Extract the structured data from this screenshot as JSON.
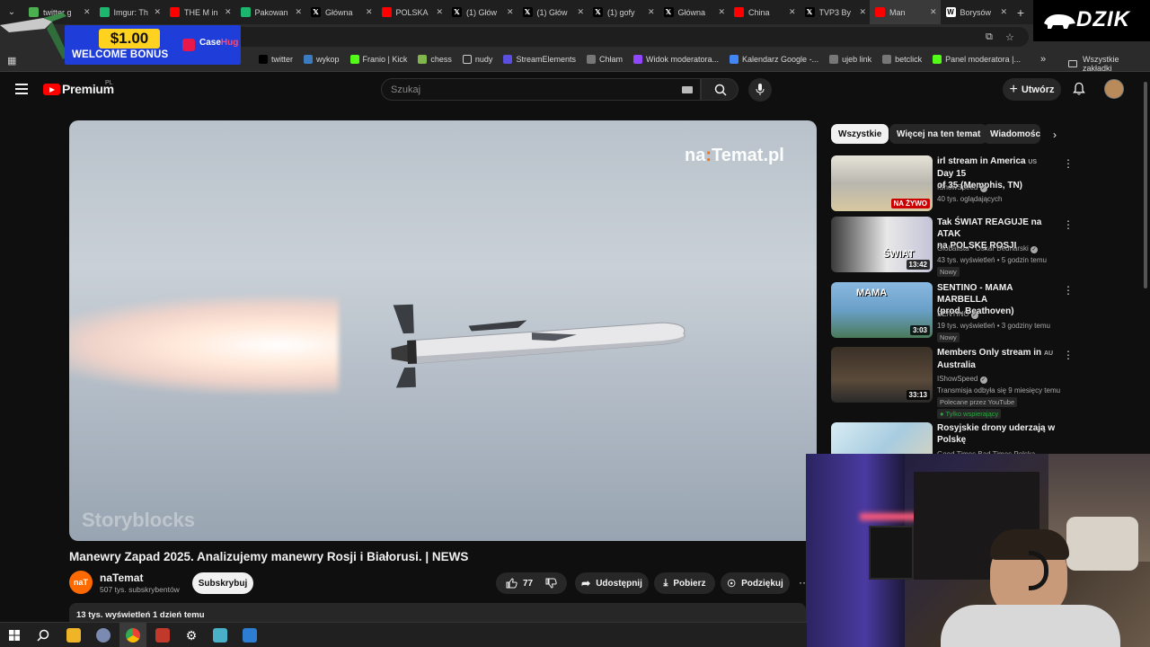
{
  "browser": {
    "tabs": [
      {
        "label": "twitter g",
        "favicon": "chrome-icon",
        "color": "#4caf50"
      },
      {
        "label": "Imgur: Th",
        "favicon": "imgur-icon",
        "color": "#1bb76e"
      },
      {
        "label": "THE M in",
        "favicon": "youtube-icon",
        "color": "#ff0000"
      },
      {
        "label": "Pakowan",
        "favicon": "imgur-icon",
        "color": "#1bb76e"
      },
      {
        "label": "Główna",
        "favicon": "x-icon",
        "color": "#000000"
      },
      {
        "label": "POLSKA",
        "favicon": "youtube-icon",
        "color": "#ff0000"
      },
      {
        "label": "(1) Głów",
        "favicon": "x-icon",
        "color": "#000000"
      },
      {
        "label": "(1) Głów",
        "favicon": "x-icon",
        "color": "#000000"
      },
      {
        "label": "(1) gofy",
        "favicon": "x-icon",
        "color": "#000000"
      },
      {
        "label": "Główna",
        "favicon": "x-icon",
        "color": "#000000"
      },
      {
        "label": "China",
        "favicon": "youtube-icon",
        "color": "#ff0000"
      },
      {
        "label": "TVP3 By",
        "favicon": "x-icon",
        "color": "#000000"
      },
      {
        "label": "Man",
        "favicon": "youtube-icon",
        "color": "#ff0000"
      },
      {
        "label": "Borysów",
        "favicon": "wikipedia-icon",
        "color": "#ffffff"
      }
    ],
    "bookmarks": [
      {
        "label": "twitter",
        "icon": "x-icon"
      },
      {
        "label": "wykop",
        "icon": "wykop-icon"
      },
      {
        "label": "Franio | Kick",
        "icon": "kick-icon"
      },
      {
        "label": "chess",
        "icon": "chess-icon"
      },
      {
        "label": "nudy",
        "icon": "folder-icon"
      },
      {
        "label": "StreamElements",
        "icon": "streamelements-icon"
      },
      {
        "label": "Chłam",
        "icon": "globe-icon"
      },
      {
        "label": "Widok moderatora...",
        "icon": "twitch-icon"
      },
      {
        "label": "Kalendarz Google -...",
        "icon": "calendar-icon"
      },
      {
        "label": "ujeb link",
        "icon": "globe-icon"
      },
      {
        "label": "betclick",
        "icon": "globe-icon"
      },
      {
        "label": "Panel moderatora |...",
        "icon": "kick-icon"
      }
    ],
    "bookmarks_folder_label": "Wszystkie zakładki",
    "bookmark_partial_label": "ior"
  },
  "ad": {
    "amount": "$1.00",
    "text": "WELCOME BONUS",
    "brand_a": "Case",
    "brand_b": "Hug"
  },
  "overlay": {
    "badge": "DZIK"
  },
  "youtube": {
    "logo_text": "Premium",
    "region": "PL",
    "search_placeholder": "Szukaj",
    "create_label": "Utwórz",
    "video": {
      "watermark_a": "na",
      "watermark_b": ":",
      "watermark_c": "Temat.pl",
      "stock_watermark": "Storyblocks",
      "title": "Manewry Zapad 2025. Analizujemy manewry Rosji i Białorusi. | NEWS",
      "channel_name": "naTemat",
      "channel_initials": "naT",
      "subscribers": "507 tys. subskrybentów",
      "subscribe_label": "Subskrybuj",
      "likes": "77",
      "share_label": "Udostępnij",
      "download_label": "Pobierz",
      "thanks_label": "Podziękuj",
      "views_date": "13 tys. wyświetleń  1 dzień temu"
    },
    "chips": [
      "Wszystkie",
      "Więcej na ten temat",
      "Wiadomości"
    ],
    "recommendations": [
      {
        "title_lines": [
          "irl stream in America",
          "of 35 (Memphis, TN)"
        ],
        "title_tag": "US",
        "title_tail": " Day 15",
        "channel": "IShowSpeed",
        "verified": true,
        "meta": "40 tys. oglądających",
        "badge": "",
        "extra": "",
        "extra2": "",
        "overlay": "NA ŻYWO",
        "overlay_type": "live"
      },
      {
        "title_lines": [
          "Tak ŚWIAT REAGUJE na ATAK",
          "na POLSKĘ ROSJI"
        ],
        "title_tag": "",
        "title_tail": "",
        "channel": "Globalista - Oskar Bednarski",
        "verified": true,
        "meta": "43 tys. wyświetleń • 5 godzin temu",
        "badge": "Nowy",
        "extra": "",
        "extra2": "",
        "overlay": "13:42",
        "overlay_type": "duration",
        "thumb_text": "ŚWIAT"
      },
      {
        "title_lines": [
          "SENTINO - MAMA MARBELLA",
          "(prod. Beathoven)"
        ],
        "title_tag": "",
        "title_tail": "",
        "channel": "SENTINO",
        "verified": true,
        "meta": "19 tys. wyświetleń • 3 godziny temu",
        "badge": "Nowy",
        "extra": "",
        "extra2": "",
        "overlay": "3:03",
        "overlay_type": "duration",
        "thumb_text": "MAMA"
      },
      {
        "title_lines": [
          "Members Only stream in",
          "Australia"
        ],
        "title_tag": "AU",
        "title_tail": "",
        "channel": "IShowSpeed",
        "verified": true,
        "meta": "Transmisja odbyła się 9 miesięcy temu",
        "badge": "Polecane przez YouTube",
        "extra": "Tylko wspierający",
        "extra2": "",
        "overlay": "33:13",
        "overlay_type": "duration"
      },
      {
        "title_lines": [
          "Rosyjskie drony uderzają w",
          "Polskę"
        ],
        "title_tag": "",
        "title_tail": "",
        "channel": "Good Times Bad Times Polska",
        "verified": false,
        "meta": "",
        "badge": "",
        "extra": "",
        "extra2": "",
        "overlay": "",
        "overlay_type": "none"
      }
    ]
  }
}
